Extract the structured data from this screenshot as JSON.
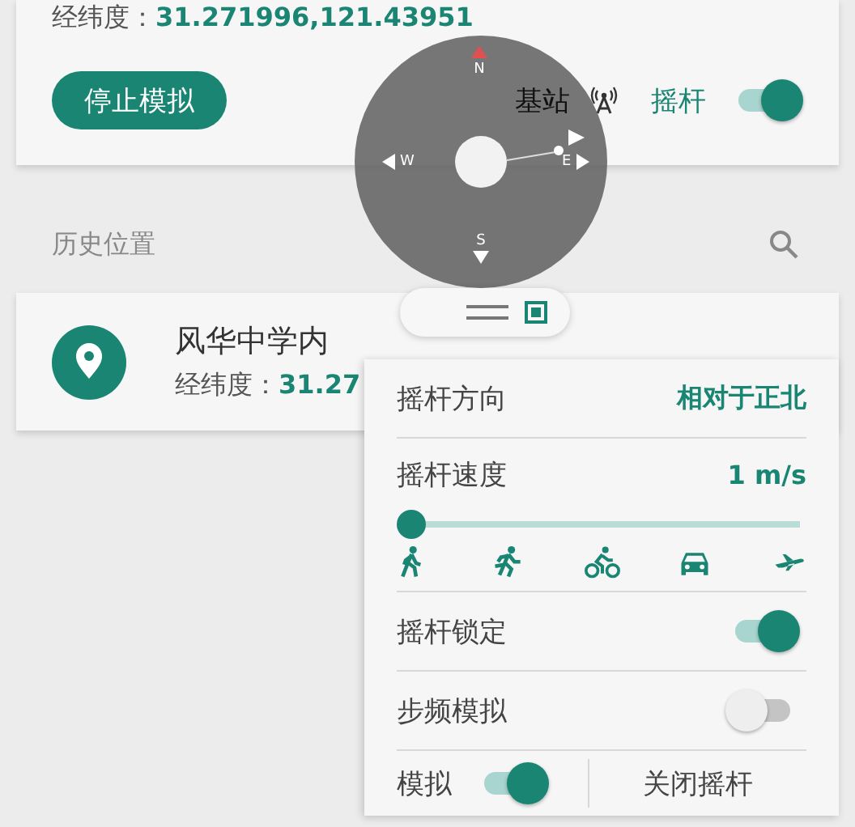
{
  "location_card": {
    "coords_label": "经纬度：",
    "coords_value": "31.271996,121.43951",
    "stop_button": "停止模拟",
    "base_station_label": "基站",
    "joystick_label": "摇杆",
    "joystick_on": true
  },
  "compass": {
    "north": "N",
    "south": "S",
    "west": "W",
    "east": "E"
  },
  "history": {
    "title": "历史位置",
    "items": [
      {
        "name": "风华中学内",
        "coords_label": "经纬度：",
        "coords_value": "31.27"
      }
    ]
  },
  "joystick_panel": {
    "rows": [
      {
        "kind": "value",
        "label": "摇杆方向",
        "value": "相对于正北"
      },
      {
        "kind": "slider",
        "label": "摇杆速度",
        "value": "1 m/s",
        "level": 0
      },
      {
        "kind": "toggle",
        "label": "摇杆锁定",
        "on": true
      },
      {
        "kind": "toggle",
        "label": "步频模拟",
        "on": false
      }
    ],
    "footer": {
      "simulate_label": "模拟",
      "simulate_on": true,
      "close_button": "关闭摇杆"
    }
  }
}
